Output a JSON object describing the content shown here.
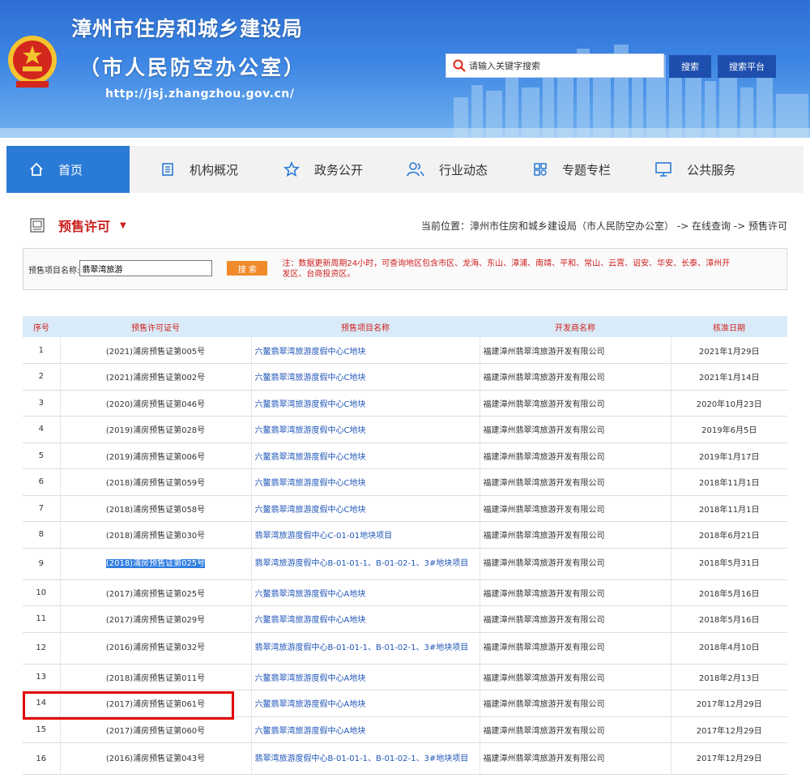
{
  "header": {
    "title": "漳州市住房和城乡建设局",
    "subtitle": "（市人民防空办公室）",
    "url": "http://jsj.zhangzhou.gov.cn/",
    "search_placeholder": "请输入关键字搜索",
    "search_button": "搜索",
    "platform_button": "搜索平台"
  },
  "nav": [
    {
      "label": "首页",
      "icon": "home-icon",
      "active": true
    },
    {
      "label": "机构概况",
      "icon": "document-icon"
    },
    {
      "label": "政务公开",
      "icon": "star-icon"
    },
    {
      "label": "行业动态",
      "icon": "users-icon"
    },
    {
      "label": "专题专栏",
      "icon": "grid-icon"
    },
    {
      "label": "公共服务",
      "icon": "monitor-icon"
    }
  ],
  "page": {
    "heading": "预售许可",
    "breadcrumb": "当前位置：漳州市住房和城乡建设局（市人民防空办公室） -> 在线查询 -> 预售许可"
  },
  "filter": {
    "label": "预售项目名称:",
    "value": "翡翠湾旅游",
    "button": "搜 索",
    "note": "注：数据更新周期24小时，可查询地区包含市区、龙海、东山、漳浦、南靖、平和、常山、云霄、诏安、华安、长泰、漳州开发区、台商投资区。"
  },
  "table": {
    "headers": [
      "序号",
      "预售许可证号",
      "预售项目名称",
      "开发商名称",
      "核准日期"
    ],
    "rows": [
      {
        "no": "1",
        "permit": "(2021)浦房预售证第005号",
        "project": "六鳌翡翠湾旅游度假中心C地块",
        "developer": "福建漳州翡翠湾旅游开发有限公司",
        "date": "2021年1月29日"
      },
      {
        "no": "2",
        "permit": "(2021)浦房预售证第002号",
        "project": "六鳌翡翠湾旅游度假中心C地块",
        "developer": "福建漳州翡翠湾旅游开发有限公司",
        "date": "2021年1月14日"
      },
      {
        "no": "3",
        "permit": "(2020)浦房预售证第046号",
        "project": "六鳌翡翠湾旅游度假中心C地块",
        "developer": "福建漳州翡翠湾旅游开发有限公司",
        "date": "2020年10月23日"
      },
      {
        "no": "4",
        "permit": "(2019)浦房预售证第028号",
        "project": "六鳌翡翠湾旅游度假中心C地块",
        "developer": "福建漳州翡翠湾旅游开发有限公司",
        "date": "2019年6月5日"
      },
      {
        "no": "5",
        "permit": "(2019)浦房预售证第006号",
        "project": "六鳌翡翠湾旅游度假中心C地块",
        "developer": "福建漳州翡翠湾旅游开发有限公司",
        "date": "2019年1月17日"
      },
      {
        "no": "6",
        "permit": "(2018)浦房预售证第059号",
        "project": "六鳌翡翠湾旅游度假中心C地块",
        "developer": "福建漳州翡翠湾旅游开发有限公司",
        "date": "2018年11月1日"
      },
      {
        "no": "7",
        "permit": "(2018)浦房预售证第058号",
        "project": "六鳌翡翠湾旅游度假中心C地块",
        "developer": "福建漳州翡翠湾旅游开发有限公司",
        "date": "2018年11月1日"
      },
      {
        "no": "8",
        "permit": "(2018)浦房预售证第030号",
        "project": "翡翠湾旅游度假中心C-01-01地块项目",
        "developer": "福建漳州翡翠湾旅游开发有限公司",
        "date": "2018年6月21日"
      },
      {
        "no": "9",
        "permit": "(2018)浦房预售证第025号",
        "project": "翡翠湾旅游度假中心B-01-01-1、B-01-02-1、3#地块项目",
        "developer": "福建漳州翡翠湾旅游开发有限公司",
        "date": "2018年5月31日"
      },
      {
        "no": "10",
        "permit": "(2017)浦房预售证第025号",
        "project": "六鳌翡翠湾旅游度假中心A地块",
        "developer": "福建漳州翡翠湾旅游开发有限公司",
        "date": "2018年5月16日"
      },
      {
        "no": "11",
        "permit": "(2017)浦房预售证第029号",
        "project": "六鳌翡翠湾旅游度假中心A地块",
        "developer": "福建漳州翡翠湾旅游开发有限公司",
        "date": "2018年5月16日"
      },
      {
        "no": "12",
        "permit": "(2016)浦房预售证第032号",
        "project": "翡翠湾旅游度假中心B-01-01-1、B-01-02-1、3#地块项目",
        "developer": "福建漳州翡翠湾旅游开发有限公司",
        "date": "2018年4月10日"
      },
      {
        "no": "13",
        "permit": "(2018)浦房预售证第011号",
        "project": "六鳌翡翠湾旅游度假中心A地块",
        "developer": "福建漳州翡翠湾旅游开发有限公司",
        "date": "2018年2月13日"
      },
      {
        "no": "14",
        "permit": "(2017)浦房预售证第061号",
        "project": "六鳌翡翠湾旅游度假中心A地块",
        "developer": "福建漳州翡翠湾旅游开发有限公司",
        "date": "2017年12月29日"
      },
      {
        "no": "15",
        "permit": "(2017)浦房预售证第060号",
        "project": "六鳌翡翠湾旅游度假中心A地块",
        "developer": "福建漳州翡翠湾旅游开发有限公司",
        "date": "2017年12月29日"
      },
      {
        "no": "16",
        "permit": "(2016)浦房预售证第043号",
        "project": "翡翠湾旅游度假中心B-01-01-1、B-01-02-1、3#地块项目",
        "developer": "福建漳州翡翠湾旅游开发有限公司",
        "date": "2017年12月29日"
      }
    ]
  },
  "colors": {
    "nav_active": "#2a7bd5",
    "heading_red": "#c8201e",
    "link_blue": "#2156b8",
    "header_row": "#d9ebf8",
    "search_btn": "#f08a2a",
    "highlight_box": "#e30000"
  }
}
